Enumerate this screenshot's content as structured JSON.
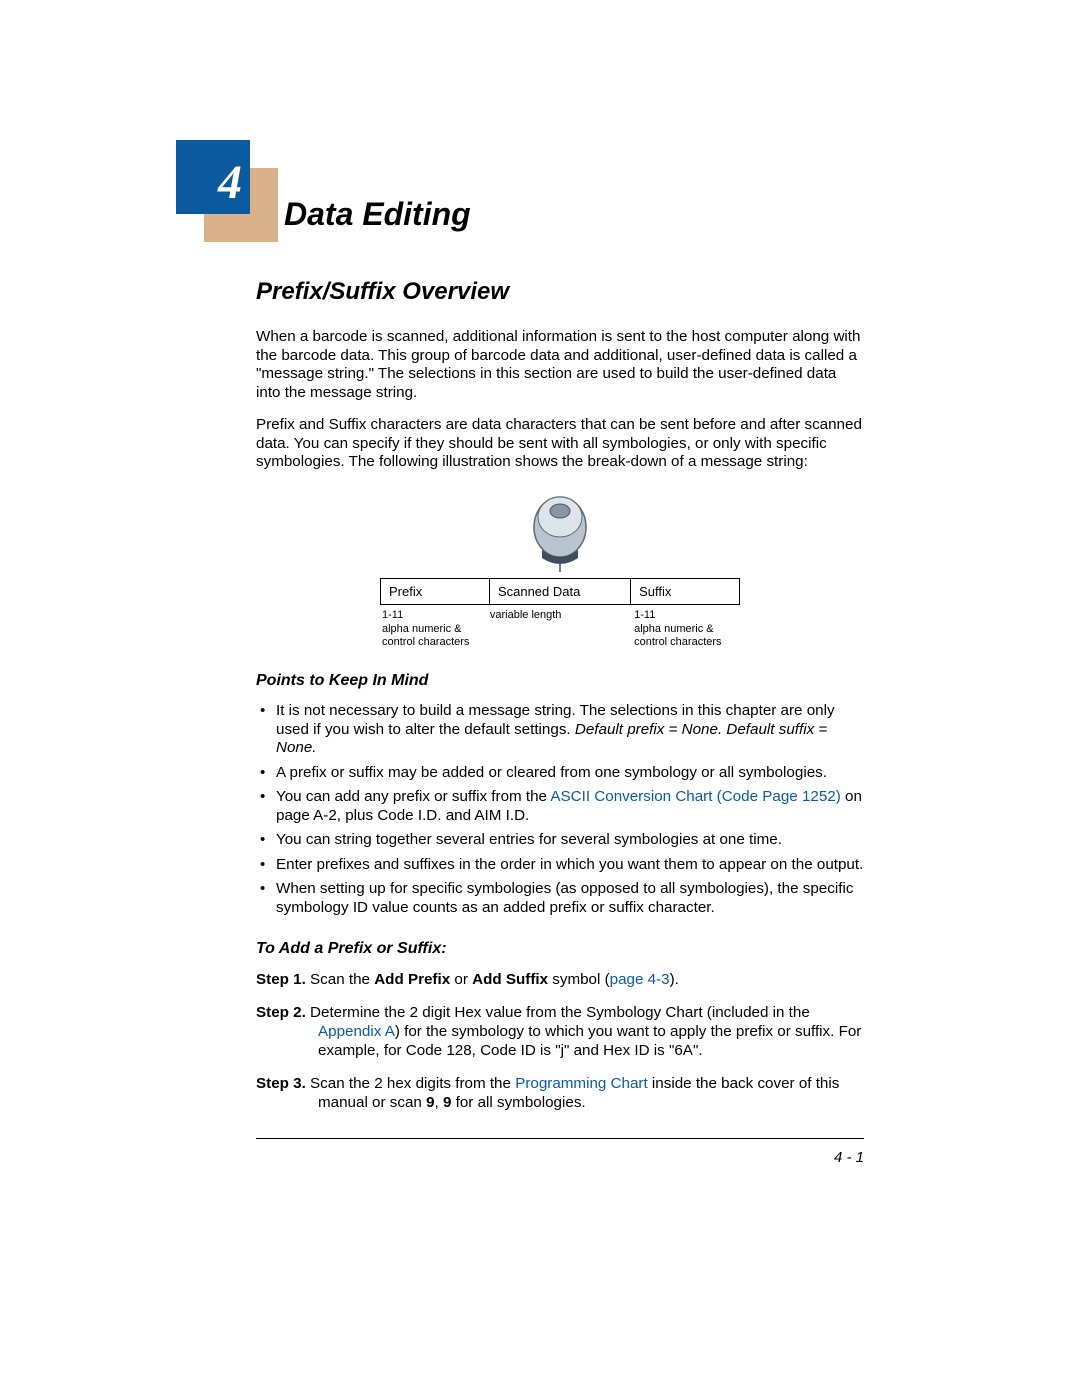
{
  "chapter": {
    "number": "4",
    "title": "Data Editing"
  },
  "section": {
    "heading": "Prefix/Suffix Overview",
    "para1": "When a barcode is scanned, additional information is sent to the host computer along with the barcode data.  This group of barcode data and additional, user-defined data is called a \"message string.\"  The selections in this section are used to build the user-defined data into the message string.",
    "para2": "Prefix and Suffix characters are data characters that can be sent before and after scanned data.  You can specify if they should be sent with all symbologies, or only with specific symbologies.  The following illustration shows the break-down of a message string:"
  },
  "diagram": {
    "cells": {
      "prefix": "Prefix",
      "scanned": "Scanned Data",
      "suffix": "Suffix"
    },
    "subs": {
      "prefix": "1-11\nalpha numeric &\ncontrol characters",
      "center": "variable length",
      "suffix": "1-11\nalpha numeric &\ncontrol characters"
    }
  },
  "points": {
    "heading": "Points to Keep In Mind",
    "items": {
      "b1_a": "It is not necessary to build a message string.  The selections in this chapter are only used if you wish to alter the default settings.  ",
      "b1_b": "Default prefix = None.  Default suffix = None.",
      "b2": "A prefix or suffix may be added or cleared from one symbology or all symbologies.",
      "b3_a": "You can add any prefix or suffix from the ",
      "b3_link": "ASCII Conversion Chart (Code Page 1252)",
      "b3_b": " on page A-2, plus Code I.D. and AIM I.D.",
      "b4": "You can string together several entries for several symbologies at one time.",
      "b5": "Enter prefixes and suffixes in the order in which you want them to appear on the output.",
      "b6": "When setting up for specific symbologies (as opposed to all symbologies), the specific symbology ID value counts as an added prefix or suffix character."
    }
  },
  "addSection": {
    "heading": "To Add a Prefix or Suffix:",
    "steps": {
      "s1": {
        "label": "Step 1.",
        "t1": "  Scan the ",
        "b1": "Add Prefix",
        "t2": " or ",
        "b2": "Add Suffix",
        "t3": " symbol (",
        "link": "page 4-3",
        "t4": ")."
      },
      "s2": {
        "label": "Step 2.",
        "t1": "  Determine the 2 digit Hex value from the Symbology Chart (included in the ",
        "link": "Appendix A",
        "t2": ") for the symbology to which you want to apply the prefix or suffix.  For example, for Code 128, Code ID is \"j\" and Hex ID is \"6A\"."
      },
      "s3": {
        "label": "Step 3.",
        "t1": "  Scan the 2 hex digits from the ",
        "link": "Programming Chart",
        "t2": " inside the back cover of this manual or scan ",
        "b1": "9",
        "t3": ", ",
        "b2": "9",
        "t4": " for all symbologies."
      }
    }
  },
  "pageNumber": "4 - 1"
}
